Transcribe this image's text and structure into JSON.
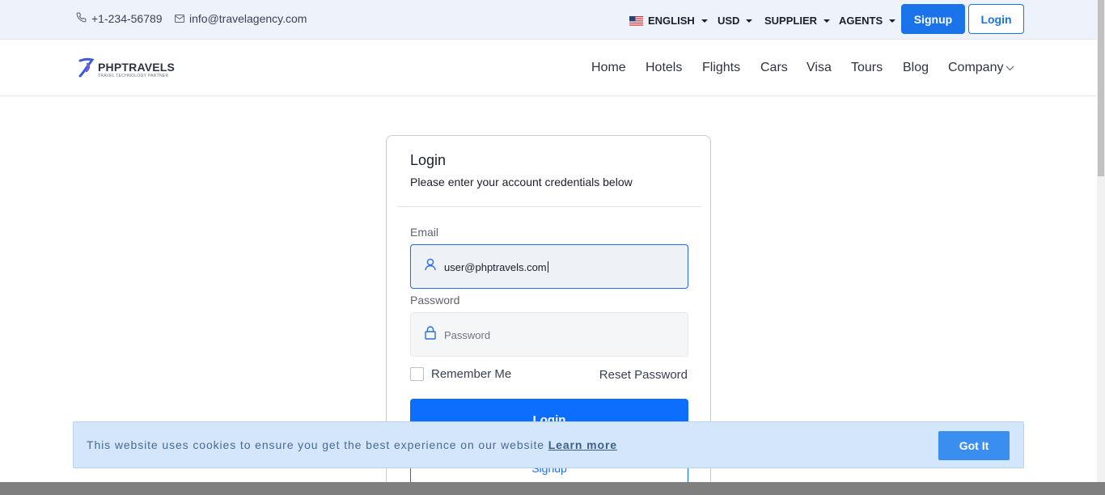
{
  "topbar": {
    "phone": "+1-234-56789",
    "email": "info@travelagency.com",
    "language": "ENGLISH",
    "currency": "USD",
    "supplier": "SUPPLIER",
    "agents": "AGENTS",
    "signup": "Signup",
    "login": "Login"
  },
  "brand": {
    "name": "PHPTRAVELS",
    "tagline": "TRAVEL TECHNOLOGY PARTNER"
  },
  "nav": {
    "home": "Home",
    "hotels": "Hotels",
    "flights": "Flights",
    "cars": "Cars",
    "visa": "Visa",
    "tours": "Tours",
    "blog": "Blog",
    "company": "Company"
  },
  "login_form": {
    "title": "Login",
    "subtitle": "Please enter your account credentials below",
    "email_label": "Email",
    "email_value": "user@phptravels.com",
    "password_label": "Password",
    "password_placeholder": "Password",
    "remember_me": "Remember Me",
    "reset_password": "Reset Password",
    "login_button": "Login",
    "signup_button": "Signup"
  },
  "cookie": {
    "message": "This website uses cookies to ensure you get the best experience on our website",
    "learn_more": "Learn more",
    "button": "Got It"
  },
  "colors": {
    "primary": "#0d6efd",
    "topbar_bg": "#eef2fb",
    "cookie_bg": "#d4e6fb",
    "cookie_button": "#3a8ef0"
  }
}
